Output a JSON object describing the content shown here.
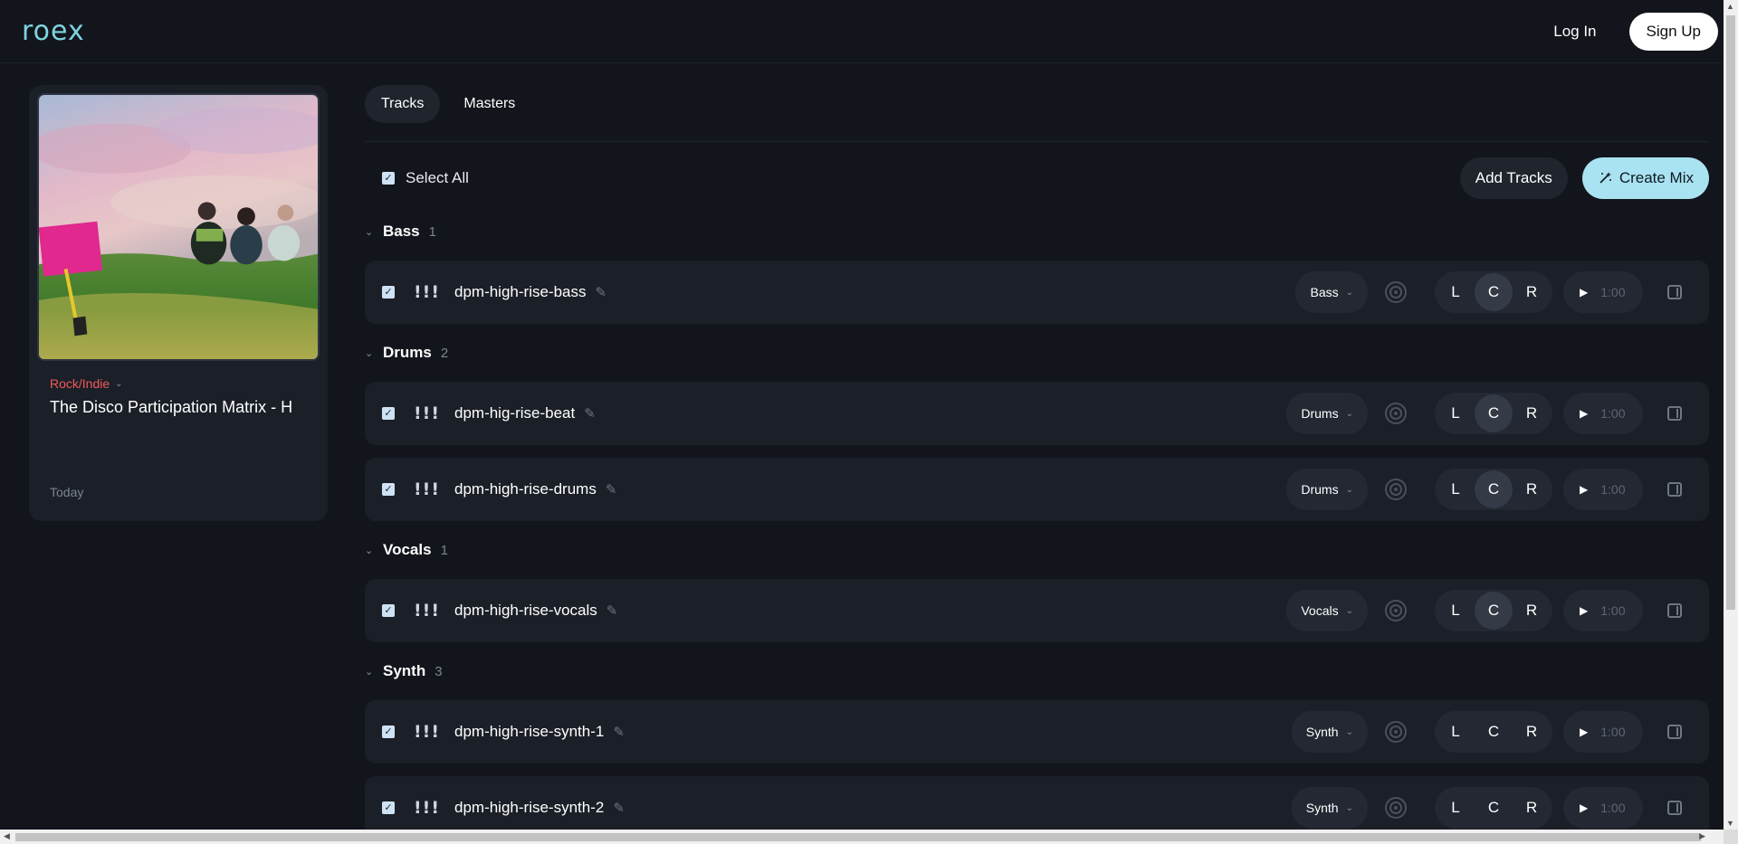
{
  "header": {
    "logo": "roex",
    "login_label": "Log In",
    "signup_label": "Sign Up"
  },
  "project": {
    "genre": "Rock/Indie",
    "title": "The Disco Participation Matrix - H",
    "date": "Today"
  },
  "tabs": [
    {
      "label": "Tracks",
      "active": true
    },
    {
      "label": "Masters",
      "active": false
    }
  ],
  "toolbar": {
    "select_all_label": "Select All",
    "add_tracks_label": "Add Tracks",
    "create_mix_label": "Create Mix"
  },
  "groups": [
    {
      "name": "Bass",
      "count": "1",
      "tracks": [
        {
          "name": "dpm-high-rise-bass",
          "stem": "Bass",
          "pan": [
            "L",
            "C",
            "R"
          ],
          "pan_selected": "C",
          "time": "1:00"
        }
      ]
    },
    {
      "name": "Drums",
      "count": "2",
      "tracks": [
        {
          "name": "dpm-hig-rise-beat",
          "stem": "Drums",
          "pan": [
            "L",
            "C",
            "R"
          ],
          "pan_selected": "C",
          "time": "1:00"
        },
        {
          "name": "dpm-high-rise-drums",
          "stem": "Drums",
          "pan": [
            "L",
            "C",
            "R"
          ],
          "pan_selected": "C",
          "time": "1:00"
        }
      ]
    },
    {
      "name": "Vocals",
      "count": "1",
      "tracks": [
        {
          "name": "dpm-high-rise-vocals",
          "stem": "Vocals",
          "pan": [
            "L",
            "C",
            "R"
          ],
          "pan_selected": "C",
          "time": "1:00"
        }
      ]
    },
    {
      "name": "Synth",
      "count": "3",
      "tracks": [
        {
          "name": "dpm-high-rise-synth-1",
          "stem": "Synth",
          "pan": [
            "L",
            "C",
            "R"
          ],
          "pan_selected": "",
          "time": "1:00"
        },
        {
          "name": "dpm-high-rise-synth-2",
          "stem": "Synth",
          "pan": [
            "L",
            "C",
            "R"
          ],
          "pan_selected": "",
          "time": "1:00"
        }
      ]
    }
  ],
  "colors": {
    "background": "#12151c",
    "card": "#1b1f27",
    "accent": "#a9e3f2",
    "logo": "#7fd3e0",
    "genre": "#f05a5a"
  }
}
